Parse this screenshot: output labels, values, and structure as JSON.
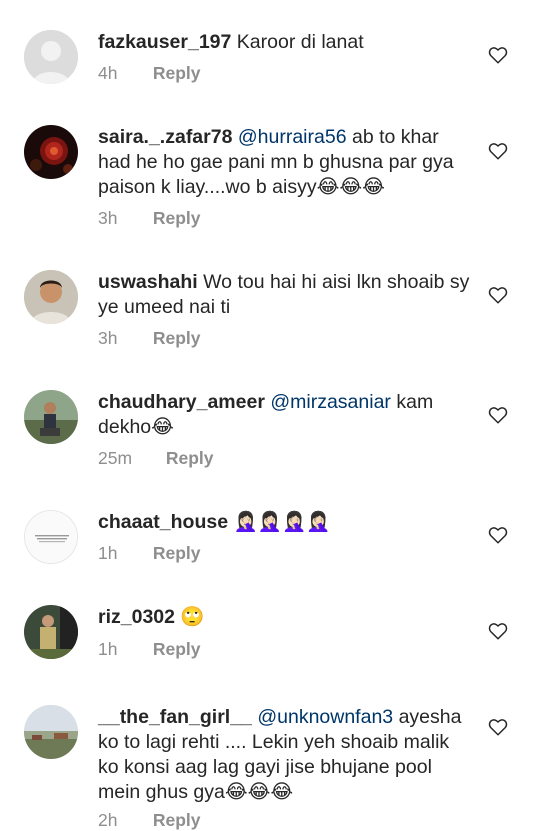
{
  "comments": [
    {
      "username": "fazkauser_197",
      "mention": "",
      "text": "Karoor di lanat",
      "time": "4h",
      "reply": "Reply"
    },
    {
      "username": "saira._.zafar78",
      "mention": "@hurraira56",
      "text": "ab to khar had he ho gae pani mn b ghusna par gya paison k liay....wo b aisyy😂😂😂",
      "time": "3h",
      "reply": "Reply"
    },
    {
      "username": "uswashahi",
      "mention": "",
      "text": "Wo tou hai hi aisi lkn shoaib sy ye umeed nai ti",
      "time": "3h",
      "reply": "Reply"
    },
    {
      "username": "chaudhary_ameer",
      "mention": "@mirzasaniar",
      "text": " kam dekho😂",
      "time": "25m",
      "reply": "Reply"
    },
    {
      "username": "chaaat_house",
      "mention": "",
      "text": "🤦🏻‍♀️🤦🏻‍♀️🤦🏻‍♀️🤦🏻‍♀️",
      "time": "1h",
      "reply": "Reply"
    },
    {
      "username": "riz_0302",
      "mention": "",
      "text": "🙄",
      "time": "1h",
      "reply": "Reply"
    },
    {
      "username": "__the_fan_girl__",
      "mention": "@unknownfan3",
      "text": "ayesha ko to lagi rehti .... Lekin yeh shoaib malik ko konsi aag lag gayi jise bhujane pool mein ghus gya😂😂😂",
      "time": "2h",
      "reply": "Reply"
    }
  ]
}
